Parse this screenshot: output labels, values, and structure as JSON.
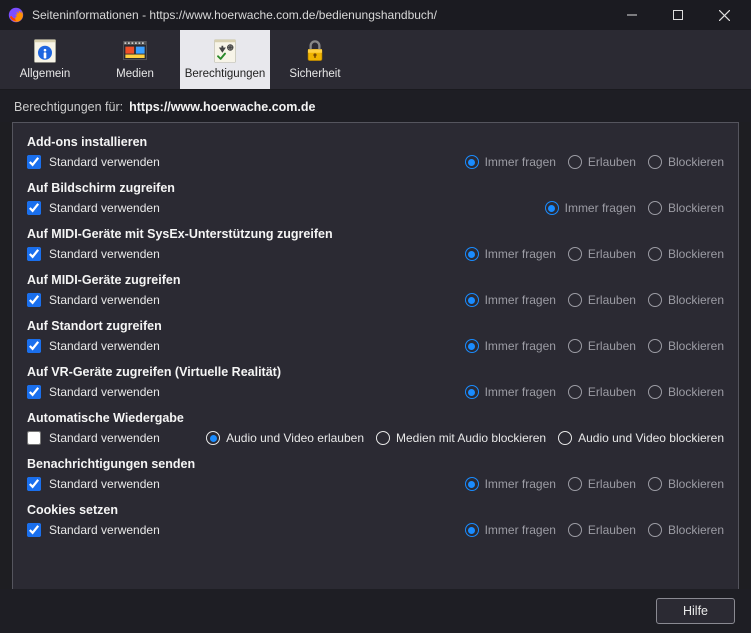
{
  "window": {
    "title": "Seiteninformationen - https://www.hoerwache.com.de/bedienungshandbuch/"
  },
  "toolbar": {
    "items": [
      {
        "id": "allgemein",
        "label": "Allgemein",
        "active": false
      },
      {
        "id": "medien",
        "label": "Medien",
        "active": false
      },
      {
        "id": "berechtigungen",
        "label": "Berechtigungen",
        "active": true
      },
      {
        "id": "sicherheit",
        "label": "Sicherheit",
        "active": false
      }
    ]
  },
  "subheader": {
    "prefix": "Berechtigungen für:",
    "url": "https://www.hoerwache.com.de"
  },
  "std_label": "Standard verwenden",
  "opt_labels": {
    "ask": "Immer fragen",
    "allow": "Erlauben",
    "block": "Blockieren"
  },
  "autoplay_opts": {
    "allow_av": "Audio und Video erlauben",
    "block_audio": "Medien mit Audio blockieren",
    "block_av": "Audio und Video blockieren"
  },
  "permissions": [
    {
      "title": "Add-ons installieren",
      "std_checked": true,
      "type": "three",
      "disabled": true,
      "selected": "ask"
    },
    {
      "title": "Auf Bildschirm zugreifen",
      "std_checked": true,
      "type": "two",
      "disabled": true,
      "selected": "ask"
    },
    {
      "title": "Auf MIDI-Geräte mit SysEx-Unterstützung zugreifen",
      "std_checked": true,
      "type": "three",
      "disabled": true,
      "selected": "ask"
    },
    {
      "title": "Auf MIDI-Geräte zugreifen",
      "std_checked": true,
      "type": "three",
      "disabled": true,
      "selected": "ask"
    },
    {
      "title": "Auf Standort zugreifen",
      "std_checked": true,
      "type": "three",
      "disabled": true,
      "selected": "ask"
    },
    {
      "title": "Auf VR-Geräte zugreifen (Virtuelle Realität)",
      "std_checked": true,
      "type": "three",
      "disabled": true,
      "selected": "ask"
    },
    {
      "title": "Automatische Wiedergabe",
      "std_checked": false,
      "type": "autoplay",
      "disabled": false,
      "selected": "allow_av"
    },
    {
      "title": "Benachrichtigungen senden",
      "std_checked": true,
      "type": "three",
      "disabled": true,
      "selected": "ask"
    },
    {
      "title": "Cookies setzen",
      "std_checked": true,
      "type": "three",
      "disabled": true,
      "selected": "ask"
    }
  ],
  "buttons": {
    "help": "Hilfe"
  }
}
